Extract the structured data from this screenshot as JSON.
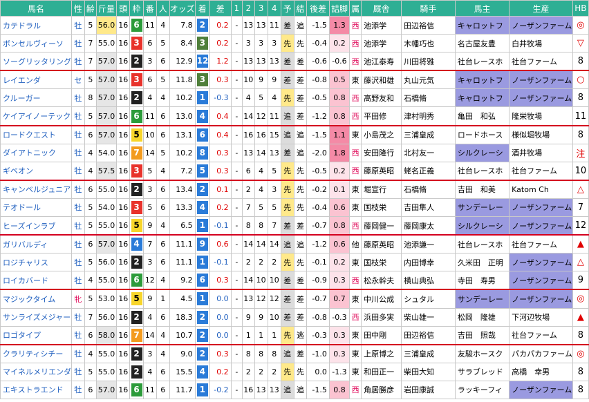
{
  "headers": [
    "馬名",
    "性",
    "齢",
    "斤量",
    "頭",
    "枠",
    "番",
    "人",
    "オッズ",
    "着",
    "差",
    "1",
    "2",
    "3",
    "4",
    "予",
    "結",
    "後差",
    "詰脚",
    "属",
    "厩舎",
    "騎手",
    "馬主",
    "生産",
    "HB"
  ],
  "rows": [
    {
      "name": "カテドラル",
      "sex": "牡",
      "age": "5",
      "kin": "56.0",
      "to": "16",
      "waku": "6",
      "ban": "11",
      "nin": "4",
      "odds": "7.8",
      "chaku": "2",
      "sa": "0.2",
      "c1": "-",
      "c2": "13",
      "c3": "13",
      "c4": "11",
      "yo": "差",
      "ketsu": "追",
      "kosa": "-1.5",
      "tsume": "1.3",
      "zoku": "西",
      "kyusha": "池添学",
      "kishu": "田辺裕信",
      "banushi": "キャロットフ",
      "seisan": "ノーザンファーム",
      "hb": "◎"
    },
    {
      "name": "ボンセルヴィーソ",
      "sex": "牡",
      "age": "7",
      "kin": "55.0",
      "to": "16",
      "waku": "3",
      "ban": "6",
      "nin": "5",
      "odds": "8.4",
      "chaku": "3",
      "sa": "0.2",
      "c1": "-",
      "c2": "3",
      "c3": "3",
      "c4": "3",
      "yo": "先",
      "ketsu": "先",
      "kosa": "-0.4",
      "tsume": "0.2",
      "zoku": "西",
      "kyusha": "池添学",
      "kishu": "木幡巧也",
      "banushi": "名古屋友豊",
      "seisan": "白井牧場",
      "hb": "▽"
    },
    {
      "name": "ソーグリッタリング",
      "sex": "牡",
      "age": "7",
      "kin": "57.0",
      "to": "16",
      "waku": "2",
      "ban": "3",
      "nin": "6",
      "odds": "12.9",
      "chaku": "12",
      "sa": "1.2",
      "c1": "-",
      "c2": "13",
      "c3": "13",
      "c4": "13",
      "yo": "差",
      "ketsu": "差",
      "kosa": "-0.6",
      "tsume": "-0.6",
      "zoku": "西",
      "kyusha": "池江泰寿",
      "kishu": "川田将雅",
      "banushi": "社台レースホ",
      "seisan": "社台ファーム",
      "hb": "8"
    },
    {
      "name": "レイエンダ",
      "sex": "セ",
      "age": "5",
      "kin": "57.0",
      "to": "16",
      "waku": "3",
      "ban": "6",
      "nin": "5",
      "odds": "11.8",
      "chaku": "3",
      "sa": "0.3",
      "c1": "-",
      "c2": "10",
      "c3": "9",
      "c4": "9",
      "yo": "差",
      "ketsu": "差",
      "kosa": "-0.8",
      "tsume": "0.5",
      "zoku": "東",
      "kyusha": "藤沢和雄",
      "kishu": "丸山元気",
      "banushi": "キャロットフ",
      "seisan": "ノーザンファーム",
      "hb": "○"
    },
    {
      "name": "クルーガー",
      "sex": "牡",
      "age": "8",
      "kin": "57.0",
      "to": "16",
      "waku": "2",
      "ban": "4",
      "nin": "4",
      "odds": "10.2",
      "chaku": "1",
      "sa": "-0.3",
      "c1": "-",
      "c2": "4",
      "c3": "5",
      "c4": "4",
      "yo": "先",
      "ketsu": "差",
      "kosa": "-0.5",
      "tsume": "0.8",
      "zoku": "西",
      "kyusha": "高野友和",
      "kishu": "石橋脩",
      "banushi": "キャロットフ",
      "seisan": "ノーザンファーム",
      "hb": "8"
    },
    {
      "name": "ケイアイノーテック",
      "sex": "牡",
      "age": "5",
      "kin": "57.0",
      "to": "16",
      "waku": "6",
      "ban": "11",
      "nin": "6",
      "odds": "13.0",
      "chaku": "4",
      "sa": "0.4",
      "c1": "-",
      "c2": "14",
      "c3": "12",
      "c4": "11",
      "yo": "追",
      "ketsu": "差",
      "kosa": "-1.2",
      "tsume": "0.8",
      "zoku": "西",
      "kyusha": "平田修",
      "kishu": "津村明秀",
      "banushi": "亀田　和弘",
      "seisan": "隆栄牧場",
      "hb": "11"
    },
    {
      "name": "ロードクエスト",
      "sex": "牡",
      "age": "6",
      "kin": "57.0",
      "to": "16",
      "waku": "5",
      "ban": "10",
      "nin": "6",
      "odds": "13.1",
      "chaku": "6",
      "sa": "0.4",
      "c1": "-",
      "c2": "16",
      "c3": "16",
      "c4": "15",
      "yo": "追",
      "ketsu": "追",
      "kosa": "-1.5",
      "tsume": "1.1",
      "zoku": "東",
      "kyusha": "小島茂之",
      "kishu": "三浦皇成",
      "banushi": "ロードホース",
      "seisan": "様似堀牧場",
      "hb": "8"
    },
    {
      "name": "ダイアトニック",
      "sex": "牡",
      "age": "4",
      "kin": "54.0",
      "to": "16",
      "waku": "7",
      "ban": "14",
      "nin": "5",
      "odds": "10.2",
      "chaku": "8",
      "sa": "0.3",
      "c1": "-",
      "c2": "13",
      "c3": "14",
      "c4": "13",
      "yo": "差",
      "ketsu": "追",
      "kosa": "-2.0",
      "tsume": "1.8",
      "zoku": "西",
      "kyusha": "安田隆行",
      "kishu": "北村友一",
      "banushi": "シルクレーシ",
      "seisan": "酒井牧場",
      "hb": "注"
    },
    {
      "name": "ギベオン",
      "sex": "牡",
      "age": "4",
      "kin": "57.5",
      "to": "16",
      "waku": "3",
      "ban": "5",
      "nin": "4",
      "odds": "7.2",
      "chaku": "5",
      "sa": "0.3",
      "c1": "-",
      "c2": "6",
      "c3": "4",
      "c4": "5",
      "yo": "先",
      "ketsu": "先",
      "kosa": "-0.5",
      "tsume": "0.2",
      "zoku": "西",
      "kyusha": "藤原英昭",
      "kishu": "蛯名正義",
      "banushi": "社台レースホ",
      "seisan": "社台ファーム",
      "hb": "10"
    },
    {
      "name": "キャンベルジュニア",
      "sex": "牡",
      "age": "6",
      "kin": "55.0",
      "to": "16",
      "waku": "2",
      "ban": "3",
      "nin": "6",
      "odds": "13.4",
      "chaku": "2",
      "sa": "0.1",
      "c1": "-",
      "c2": "2",
      "c3": "4",
      "c4": "3",
      "yo": "先",
      "ketsu": "先",
      "kosa": "-0.2",
      "tsume": "0.1",
      "zoku": "東",
      "kyusha": "堀宣行",
      "kishu": "石橋脩",
      "banushi": "吉田　和美",
      "seisan": "Katom Ch",
      "hb": "△"
    },
    {
      "name": "テオドール",
      "sex": "牡",
      "age": "5",
      "kin": "54.0",
      "to": "16",
      "waku": "3",
      "ban": "5",
      "nin": "6",
      "odds": "13.3",
      "chaku": "4",
      "sa": "0.2",
      "c1": "-",
      "c2": "7",
      "c3": "5",
      "c4": "5",
      "yo": "先",
      "ketsu": "先",
      "kosa": "-0.4",
      "tsume": "0.6",
      "zoku": "東",
      "kyusha": "国枝栄",
      "kishu": "吉田隼人",
      "banushi": "サンデーレー",
      "seisan": "ノーザンファーム",
      "hb": "7"
    },
    {
      "name": "ヒーズインラブ",
      "sex": "牡",
      "age": "5",
      "kin": "55.0",
      "to": "16",
      "waku": "5",
      "ban": "9",
      "nin": "4",
      "odds": "6.5",
      "chaku": "1",
      "sa": "-0.1",
      "c1": "-",
      "c2": "8",
      "c3": "8",
      "c4": "7",
      "yo": "差",
      "ketsu": "差",
      "kosa": "-0.7",
      "tsume": "0.8",
      "zoku": "西",
      "kyusha": "藤岡健一",
      "kishu": "藤岡康太",
      "banushi": "シルクレーシ",
      "seisan": "ノーザンファーム",
      "hb": "12"
    },
    {
      "name": "ガリバルディ",
      "sex": "牡",
      "age": "6",
      "kin": "57.0",
      "to": "16",
      "waku": "4",
      "ban": "7",
      "nin": "6",
      "odds": "11.1",
      "chaku": "9",
      "sa": "0.6",
      "c1": "-",
      "c2": "14",
      "c3": "14",
      "c4": "14",
      "yo": "追",
      "ketsu": "追",
      "kosa": "-1.2",
      "tsume": "0.6",
      "zoku": "他",
      "kyusha": "藤原英昭",
      "kishu": "池添謙一",
      "banushi": "社台レースホ",
      "seisan": "社台ファーム",
      "hb": "▲"
    },
    {
      "name": "ロジチャリス",
      "sex": "牡",
      "age": "5",
      "kin": "56.0",
      "to": "16",
      "waku": "2",
      "ban": "3",
      "nin": "6",
      "odds": "11.1",
      "chaku": "1",
      "sa": "-0.1",
      "c1": "-",
      "c2": "2",
      "c3": "2",
      "c4": "2",
      "yo": "先",
      "ketsu": "先",
      "kosa": "-0.1",
      "tsume": "0.2",
      "zoku": "東",
      "kyusha": "国枝栄",
      "kishu": "内田博幸",
      "banushi": "久米田　正明",
      "seisan": "ノーザンファーム",
      "hb": "△"
    },
    {
      "name": "ロイカバード",
      "sex": "牡",
      "age": "4",
      "kin": "55.0",
      "to": "16",
      "waku": "6",
      "ban": "12",
      "nin": "4",
      "odds": "9.2",
      "chaku": "6",
      "sa": "0.3",
      "c1": "-",
      "c2": "14",
      "c3": "10",
      "c4": "10",
      "yo": "差",
      "ketsu": "差",
      "kosa": "-0.9",
      "tsume": "0.3",
      "zoku": "西",
      "kyusha": "松永幹夫",
      "kishu": "横山典弘",
      "banushi": "寺田　寿男",
      "seisan": "ノーザンファーム",
      "hb": "9"
    },
    {
      "name": "マジックタイム",
      "sex": "牝",
      "age": "5",
      "kin": "53.0",
      "to": "16",
      "waku": "5",
      "ban": "9",
      "nin": "1",
      "odds": "4.5",
      "chaku": "1",
      "sa": "0.0",
      "c1": "-",
      "c2": "13",
      "c3": "12",
      "c4": "12",
      "yo": "差",
      "ketsu": "差",
      "kosa": "-0.7",
      "tsume": "0.7",
      "zoku": "東",
      "kyusha": "中川公成",
      "kishu": "シュタル",
      "banushi": "サンデーレー",
      "seisan": "ノーザンファーム",
      "hb": "◎"
    },
    {
      "name": "サンライズメジャー",
      "sex": "牡",
      "age": "7",
      "kin": "56.0",
      "to": "16",
      "waku": "2",
      "ban": "4",
      "nin": "6",
      "odds": "18.3",
      "chaku": "2",
      "sa": "0.0",
      "c1": "-",
      "c2": "9",
      "c3": "9",
      "c4": "10",
      "yo": "差",
      "ketsu": "差",
      "kosa": "-0.8",
      "tsume": "-0.3",
      "zoku": "西",
      "kyusha": "浜田多実",
      "kishu": "柴山雄一",
      "banushi": "松岡　隆雄",
      "seisan": "下河辺牧場",
      "hb": "▲"
    },
    {
      "name": "ロゴタイプ",
      "sex": "牡",
      "age": "6",
      "kin": "58.0",
      "to": "16",
      "waku": "7",
      "ban": "14",
      "nin": "4",
      "odds": "10.7",
      "chaku": "2",
      "sa": "0.0",
      "c1": "-",
      "c2": "1",
      "c3": "1",
      "c4": "1",
      "yo": "先",
      "ketsu": "逃",
      "kosa": "-0.3",
      "tsume": "0.3",
      "zoku": "東",
      "kyusha": "田中剛",
      "kishu": "田辺裕信",
      "banushi": "吉田　照哉",
      "seisan": "社台ファーム",
      "hb": "8"
    },
    {
      "name": "クラリティシチー",
      "sex": "牡",
      "age": "4",
      "kin": "55.0",
      "to": "16",
      "waku": "2",
      "ban": "3",
      "nin": "4",
      "odds": "9.0",
      "chaku": "2",
      "sa": "0.3",
      "c1": "-",
      "c2": "8",
      "c3": "8",
      "c4": "8",
      "yo": "追",
      "ketsu": "差",
      "kosa": "-1.0",
      "tsume": "0.3",
      "zoku": "東",
      "kyusha": "上原博之",
      "kishu": "三浦皇成",
      "banushi": "友駿ホースク",
      "seisan": "パカパカファーム",
      "hb": "◎"
    },
    {
      "name": "マイネルメリエンダ",
      "sex": "牡",
      "age": "5",
      "kin": "55.0",
      "to": "16",
      "waku": "2",
      "ban": "4",
      "nin": "6",
      "odds": "15.5",
      "chaku": "4",
      "sa": "0.2",
      "c1": "-",
      "c2": "2",
      "c3": "2",
      "c4": "2",
      "yo": "先",
      "ketsu": "先",
      "kosa": "0.0",
      "tsume": "-1.3",
      "zoku": "東",
      "kyusha": "和田正一",
      "kishu": "柴田大知",
      "banushi": "サラブレッド",
      "seisan": "高橋　幸男",
      "hb": "8"
    },
    {
      "name": "エキストラエンド",
      "sex": "牡",
      "age": "6",
      "kin": "57.0",
      "to": "16",
      "waku": "6",
      "ban": "11",
      "nin": "6",
      "odds": "11.7",
      "chaku": "1",
      "sa": "-0.2",
      "c1": "-",
      "c2": "16",
      "c3": "13",
      "c4": "13",
      "yo": "追",
      "ketsu": "追",
      "kosa": "-1.5",
      "tsume": "0.8",
      "zoku": "西",
      "kyusha": "角居勝彦",
      "kishu": "岩田康誠",
      "banushi": "ラッキーフィ",
      "seisan": "ノーザンファーム",
      "hb": "8"
    }
  ]
}
